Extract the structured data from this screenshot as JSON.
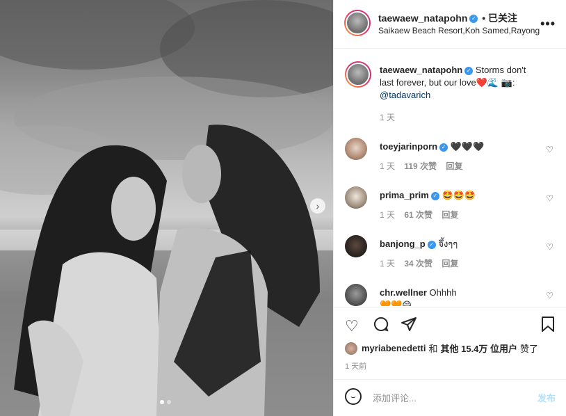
{
  "post": {
    "author": "taewaew_natapohn",
    "follow_state": "• 已关注",
    "location": "Saikaew Beach Resort,Koh Samed,Rayong",
    "more_glyph": "•••",
    "caption_text": "Storms don't last forever, but our love❤️🌊 📷:",
    "caption_mention": "@tadavarich",
    "caption_time": "1 天",
    "carousel_next_glyph": "›"
  },
  "comments": [
    {
      "user": "toeyjarinporn",
      "text": "🖤🖤🖤",
      "time": "1 天",
      "likes": "119 次赞",
      "reply": "回复"
    },
    {
      "user": "prima_prim",
      "text": "🤩🤩🤩",
      "time": "1 天",
      "likes": "61 次赞",
      "reply": "回复"
    },
    {
      "user": "banjong_p",
      "text": "จึ้งๆๆ",
      "time": "1 天",
      "likes": "34 次赞",
      "reply": "回复"
    },
    {
      "user": "chr.wellner",
      "text": "Ohhhh",
      "line2": "🧡🧡😄"
    }
  ],
  "actions": {
    "likes_user": "myriabenedetti",
    "likes_mid": "和",
    "likes_rest": "其他 15.4万 位用户",
    "likes_end": "赞了",
    "posted_time": "1 天前"
  },
  "comment_box": {
    "placeholder": "添加评论...",
    "post_label": "发布"
  }
}
